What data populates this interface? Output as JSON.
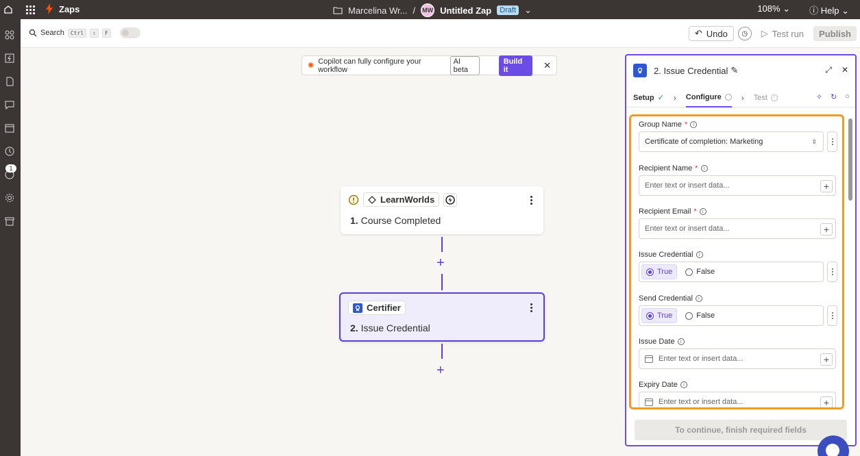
{
  "topbar": {
    "app_name": "Zaps",
    "folder": "Marcelina Wr...",
    "separator": "/",
    "avatar_initials": "MW",
    "zap_name": "Untitled Zap",
    "status": "Draft",
    "zoom": "108%",
    "help": "Help"
  },
  "rail": {
    "notification_count": "1"
  },
  "toolbar": {
    "search_label": "Search",
    "shortcut_ctrl": "Ctrl",
    "shortcut_shift": "⇧",
    "shortcut_key": "F",
    "undo_label": "Undo",
    "test_run_label": "Test run",
    "publish_label": "Publish"
  },
  "copilot": {
    "message": "Copilot can fully configure your workflow",
    "badge": "AI beta",
    "button": "Build it"
  },
  "steps": [
    {
      "app": "LearnWorlds",
      "number": "1.",
      "title": "Course Completed"
    },
    {
      "app": "Certifier",
      "number": "2.",
      "title": "Issue Credential"
    }
  ],
  "panel": {
    "title": "2. Issue Credential",
    "tabs": {
      "setup": "Setup",
      "configure": "Configure",
      "test": "Test"
    },
    "fields": {
      "group_name": {
        "label": "Group Name",
        "value": "Certificate of completion: Marketing"
      },
      "recipient_name": {
        "label": "Recipient Name",
        "placeholder": "Enter text or insert data..."
      },
      "recipient_email": {
        "label": "Recipient Email",
        "placeholder": "Enter text or insert data..."
      },
      "issue_credential": {
        "label": "Issue Credential",
        "option_true": "True",
        "option_false": "False"
      },
      "send_credential": {
        "label": "Send Credential",
        "option_true": "True",
        "option_false": "False"
      },
      "issue_date": {
        "label": "Issue Date",
        "placeholder": "Enter text or insert data..."
      },
      "expiry_date": {
        "label": "Expiry Date",
        "placeholder": "Enter text or insert data..."
      }
    },
    "required_mark": "*",
    "continue_label": "To continue, finish required fields"
  },
  "colors": {
    "topbar_bg": "#3b3534",
    "accent_purple": "#6b4ce6",
    "highlight_orange": "#f29a24",
    "zap_orange": "#ff4f00"
  }
}
